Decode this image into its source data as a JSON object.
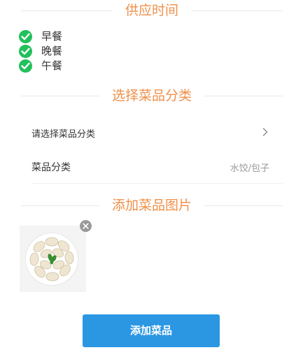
{
  "supply_time": {
    "title": "供应时间",
    "meals": [
      {
        "label": "早餐",
        "checked": true
      },
      {
        "label": "晚餐",
        "checked": true
      },
      {
        "label": "午餐",
        "checked": true
      }
    ]
  },
  "category_section": {
    "title": "选择菜品分类",
    "select_row": {
      "label": "请选择菜品分类",
      "icon": "chevron-right-icon"
    },
    "category_row": {
      "label": "菜品分类",
      "value": "水饺/包子"
    }
  },
  "image_section": {
    "title": "添加菜品图片",
    "thumbnail": {
      "description_icon": "dumpling-plate-image",
      "remove_icon": "close-icon"
    }
  },
  "submit": {
    "label": "添加菜品"
  },
  "colors": {
    "section_title": "#f0904a",
    "check": "#21c05a",
    "button": "#2b97e3",
    "muted_text": "#999999"
  }
}
